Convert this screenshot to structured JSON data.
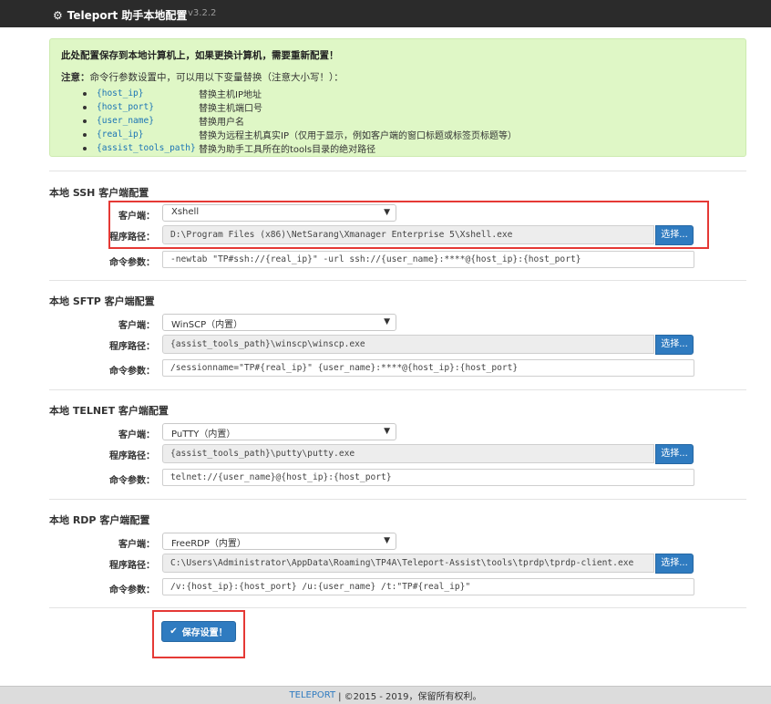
{
  "app": {
    "title": "Teleport 助手本地配置",
    "version": "v3.2.2",
    "gear_icon": "⚙"
  },
  "notice": {
    "headline": "此处配置保存到本地计算机上，如果更换计算机，需要重新配置！",
    "intro_bold": "注意：",
    "intro_rest": "命令行参数设置中，可以用以下变量替换（注意大小写！）：",
    "variables": [
      {
        "var": "{host_ip}",
        "desc": "替换主机IP地址"
      },
      {
        "var": "{host_port}",
        "desc": "替换主机端口号"
      },
      {
        "var": "{user_name}",
        "desc": "替换用户名"
      },
      {
        "var": "{real_ip}",
        "desc": "替换为远程主机真实IP（仅用于显示，例如客户端的窗口标题或标签页标题等）"
      },
      {
        "var": "{assist_tools_path}",
        "desc": "替换为助手工具所在的tools目录的绝对路径"
      }
    ]
  },
  "labels": {
    "client": "客户端：",
    "path": "程序路径：",
    "args": "命令参数：",
    "pick_button": "选择..."
  },
  "sections": [
    {
      "title": "本地 SSH 客户端配置",
      "client": "Xshell",
      "path": "D:\\Program Files (x86)\\NetSarang\\Xmanager Enterprise 5\\Xshell.exe",
      "args": "-newtab \"TP#ssh://{real_ip}\" -url ssh://{user_name}:****@{host_ip}:{host_port}"
    },
    {
      "title": "本地 SFTP 客户端配置",
      "client": "WinSCP（内置）",
      "path": "{assist_tools_path}\\winscp\\winscp.exe",
      "args": "/sessionname=\"TP#{real_ip}\" {user_name}:****@{host_ip}:{host_port}"
    },
    {
      "title": "本地 TELNET 客户端配置",
      "client": "PuTTY（内置）",
      "path": "{assist_tools_path}\\putty\\putty.exe",
      "args": "telnet://{user_name}@{host_ip}:{host_port}"
    },
    {
      "title": "本地 RDP 客户端配置",
      "client": "FreeRDP（内置）",
      "path": "C:\\Users\\Administrator\\AppData\\Roaming\\TP4A\\Teleport-Assist\\tools\\tprdp\\tprdp-client.exe",
      "args": "/v:{host_ip}:{host_port} /u:{user_name} /t:\"TP#{real_ip}\""
    }
  ],
  "save_button": "保存设置！",
  "footer": {
    "brand": "TELEPORT",
    "rest": "| ©2015 - 2019，保留所有权利。"
  },
  "colors": {
    "topbar": "#2b2b2b",
    "notice_bg": "#dff7c6",
    "primary": "#2f7bc0",
    "highlight": "#e53935"
  }
}
